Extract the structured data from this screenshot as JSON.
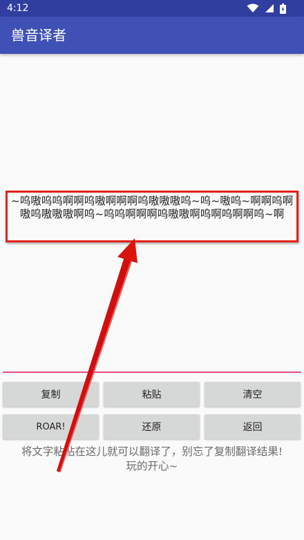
{
  "status_bar": {
    "time": "4:12",
    "icons": [
      "wifi-icon",
      "signal-icon",
      "battery-icon"
    ]
  },
  "app_bar": {
    "title": "兽音译者"
  },
  "output": {
    "text": "~呜嗷呜呜啊啊呜嗷啊啊啊呜嗷嗷嗷呜~呜~嗷呜~啊啊呜啊嗷呜嗷嗷嗷啊呜~呜呜啊啊啊呜嗷嗷啊呜啊呜啊啊呜~啊"
  },
  "buttons": {
    "copy": "复制",
    "paste": "粘贴",
    "clear": "清空",
    "roar": "ROAR!",
    "restore": "还原",
    "back": "返回"
  },
  "hint": {
    "line1": "将文字粘贴在这儿就可以翻译了，别忘了复制翻译结果!",
    "line2": "玩的开心~"
  },
  "colors": {
    "status_bar": "#303f9f",
    "app_bar": "#3f51b5",
    "input_underline": "#e94b7d",
    "annotation": "#e2231a",
    "button_bg": "#d6d7d7"
  }
}
